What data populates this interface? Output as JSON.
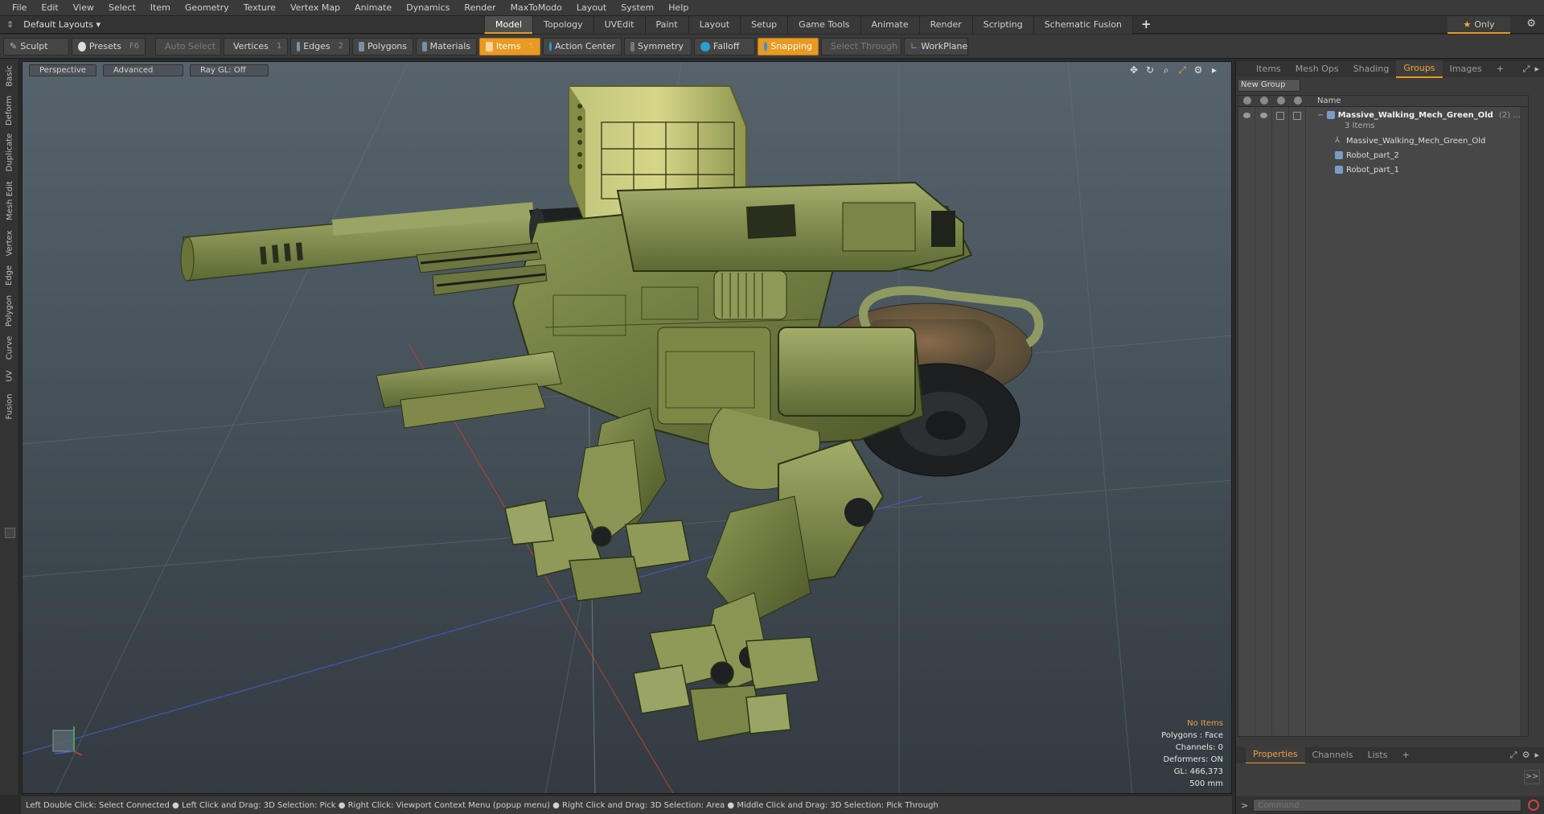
{
  "menubar": [
    "File",
    "Edit",
    "View",
    "Select",
    "Item",
    "Geometry",
    "Texture",
    "Vertex Map",
    "Animate",
    "Dynamics",
    "Render",
    "MaxToModo",
    "Layout",
    "System",
    "Help"
  ],
  "layouts_label": "Default Layouts",
  "layout_tabs": [
    "Model",
    "Topology",
    "UVEdit",
    "Paint",
    "Layout",
    "Setup",
    "Game Tools",
    "Animate",
    "Render",
    "Scripting",
    "Schematic Fusion"
  ],
  "layout_tabs_active": "Model",
  "add_tab": "+",
  "only_label": "Only",
  "toolbar": {
    "sculpt": "Sculpt",
    "presets": "Presets",
    "presets_key": "F6",
    "auto_select": "Auto Select",
    "vertices": "Vertices",
    "vertices_key": "1",
    "edges": "Edges",
    "edges_key": "2",
    "polygons": "Polygons",
    "materials": "Materials",
    "items": "Items",
    "items_key": "5",
    "action_center": "Action Center",
    "symmetry": "Symmetry",
    "falloff": "Falloff",
    "snapping": "Snapping",
    "select_through": "Select Through",
    "workplane": "WorkPlane"
  },
  "left_tabs": [
    "Basic",
    "Deform",
    "Duplicate",
    "Mesh Edit",
    "Vertex",
    "Edge",
    "Polygon",
    "Curve",
    "UV",
    "Fusion"
  ],
  "viewport": {
    "view": "Perspective",
    "shading": "Advanced",
    "raygl": "Ray GL: Off",
    "stats": {
      "items": "No Items",
      "polygons": "Polygons : Face",
      "channels": "Channels: 0",
      "deformers": "Deformers: ON",
      "gl": "GL: 466,373",
      "scale": "500 mm"
    }
  },
  "statusbar": "Left Double Click: Select Connected ● Left Click and Drag: 3D Selection: Pick ● Right Click: Viewport Context Menu (popup menu) ● Right Click and Drag: 3D Selection: Area ● Middle Click and Drag: 3D Selection: Pick Through",
  "right_panel": {
    "tabs": [
      "Items",
      "Mesh Ops",
      "Shading",
      "Groups",
      "Images"
    ],
    "active_tab": "Groups",
    "add": "+",
    "new_group": "New Group",
    "column_name": "Name",
    "group": {
      "name": "Massive_Walking_Mech_Green_Old",
      "count": "(2)",
      "sub": "3 Items",
      "children": [
        "Massive_Walking_Mech_Green_Old",
        "Robot_part_2",
        "Robot_part_1"
      ]
    },
    "bottom_tabs": [
      "Properties",
      "Channels",
      "Lists"
    ],
    "bottom_active": "Properties",
    "expand": ">>",
    "command_placeholder": "Command"
  },
  "colors": {
    "accent": "#e89a22",
    "viewport_top": "#56636c",
    "viewport_bottom": "#333b41",
    "mech_green": "#7a8a4a"
  }
}
